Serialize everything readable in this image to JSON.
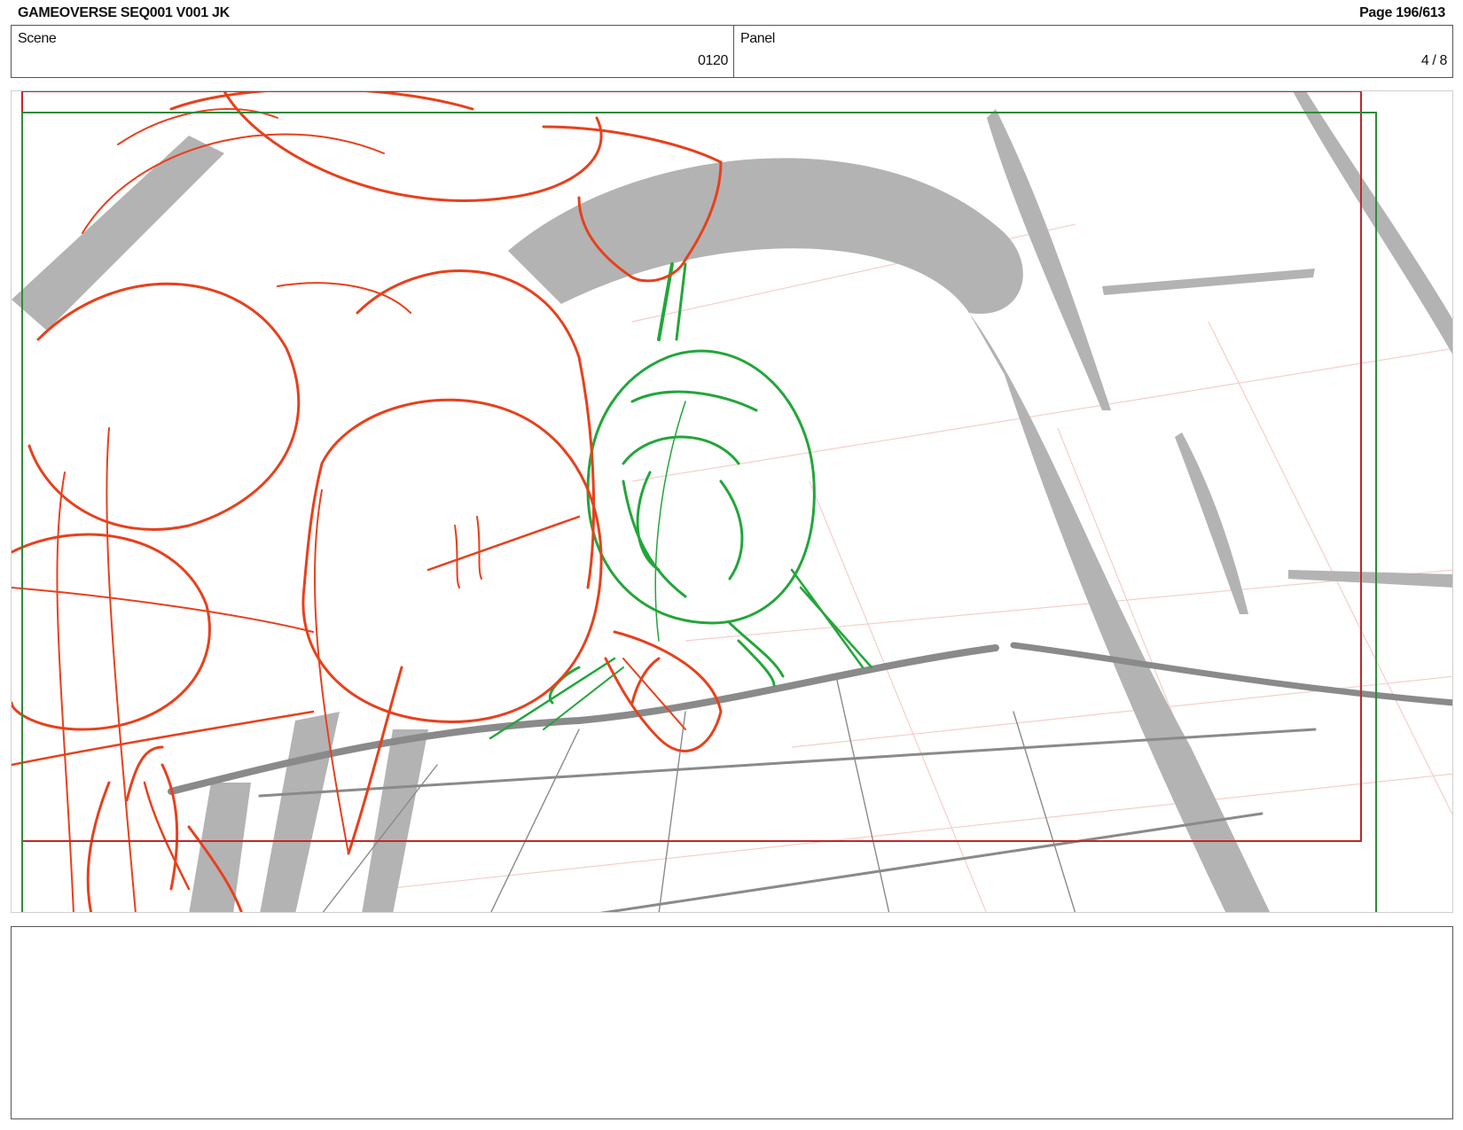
{
  "header": {
    "title": "GAMEOVERSE SEQ001 V001 JK",
    "page": "Page 196/613"
  },
  "info": {
    "scene_label": "Scene",
    "scene_value": "0120",
    "panel_label": "Panel",
    "panel_value": "4 / 8"
  },
  "drawing": {
    "colors": {
      "rough_red": "#e8401c",
      "rough_green": "#22a63a",
      "shadow_gray": "#b3b3b3",
      "line_gray": "#8a8a8a",
      "guide_red": "#c0282a",
      "guide_green": "#2e8b3a",
      "perspective_pink": "#f3c9c4"
    }
  },
  "notes": {
    "action": ""
  }
}
